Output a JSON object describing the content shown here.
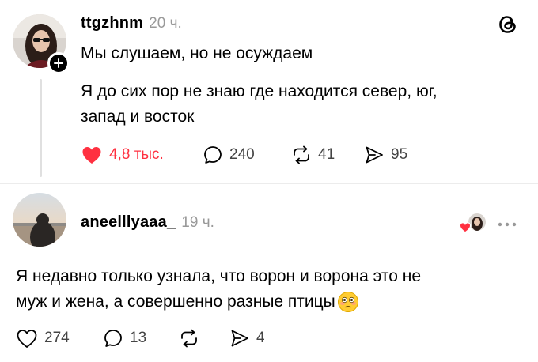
{
  "post": {
    "username": "ttgzhnm",
    "time": "20 ч.",
    "line1": "Мы слушаем, но не осуждаем",
    "line2": "Я до сих пор не знаю где находится север, юг,",
    "line3": "запад и восток",
    "likes": "4,8 тыс.",
    "comments": "240",
    "reposts": "41",
    "shares": "95",
    "liked": true
  },
  "reply": {
    "username": "aneelllyaaa_",
    "time": "19 ч.",
    "line1": "Я недавно только узнала, что ворон и ворона это не",
    "line2": "муж и жена, а совершенно разные птицы",
    "likes": "274",
    "comments": "13",
    "reposts": "",
    "shares": "4"
  },
  "icons": {
    "app_logo": "threads-logo-icon",
    "like_liked": "heart-filled-icon",
    "like": "heart-outline-icon",
    "comment": "speech-bubble-icon",
    "repost": "repost-icon",
    "share": "send-icon",
    "follow": "plus-icon",
    "more": "more-dots-icon",
    "emoji": "flushed-face-emoji"
  },
  "colors": {
    "liked_red": "#ff3040",
    "meta_gray": "#999999",
    "thread_line": "#e0e0e0"
  }
}
